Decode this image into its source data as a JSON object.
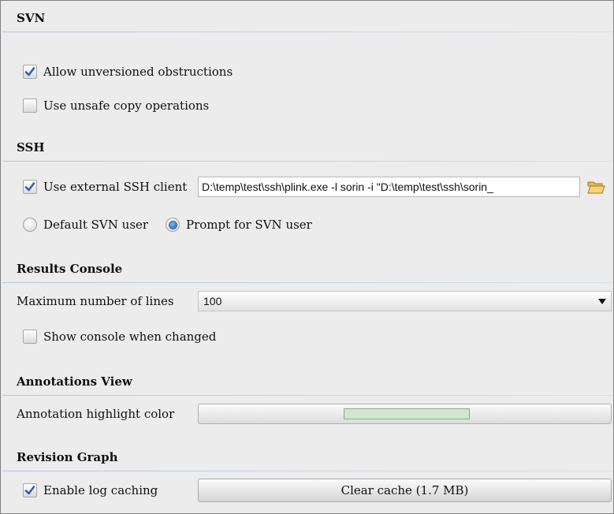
{
  "svn": {
    "title": "SVN",
    "allow_unversioned": {
      "label": "Allow unversioned obstructions",
      "checked": true
    },
    "unsafe_copy": {
      "label": "Use unsafe copy operations",
      "checked": false
    }
  },
  "ssh": {
    "title": "SSH",
    "external_client": {
      "label": "Use external SSH client",
      "checked": true,
      "value": "D:\\temp\\test\\ssh\\plink.exe -l sorin -i \"D:\\temp\\test\\ssh\\sorin_"
    },
    "browse_icon": "folder-open-icon",
    "user_mode": {
      "options": [
        "Default SVN user",
        "Prompt for SVN user"
      ],
      "selected": "Prompt for SVN user"
    }
  },
  "results_console": {
    "title": "Results Console",
    "max_lines": {
      "label": "Maximum number of lines",
      "value": "100"
    },
    "show_console": {
      "label": "Show console when changed",
      "checked": false
    }
  },
  "annotations_view": {
    "title": "Annotations View",
    "highlight": {
      "label": "Annotation highlight color",
      "color": "#cfe8cf"
    }
  },
  "revision_graph": {
    "title": "Revision Graph",
    "log_caching": {
      "label": "Enable log caching",
      "checked": true
    },
    "clear_cache_label": "Clear cache (1.7 MB)"
  },
  "colors": {
    "check_mark": "#2f5fae",
    "header_rule": "#b5c7dc",
    "panel_background": "#ececec"
  }
}
